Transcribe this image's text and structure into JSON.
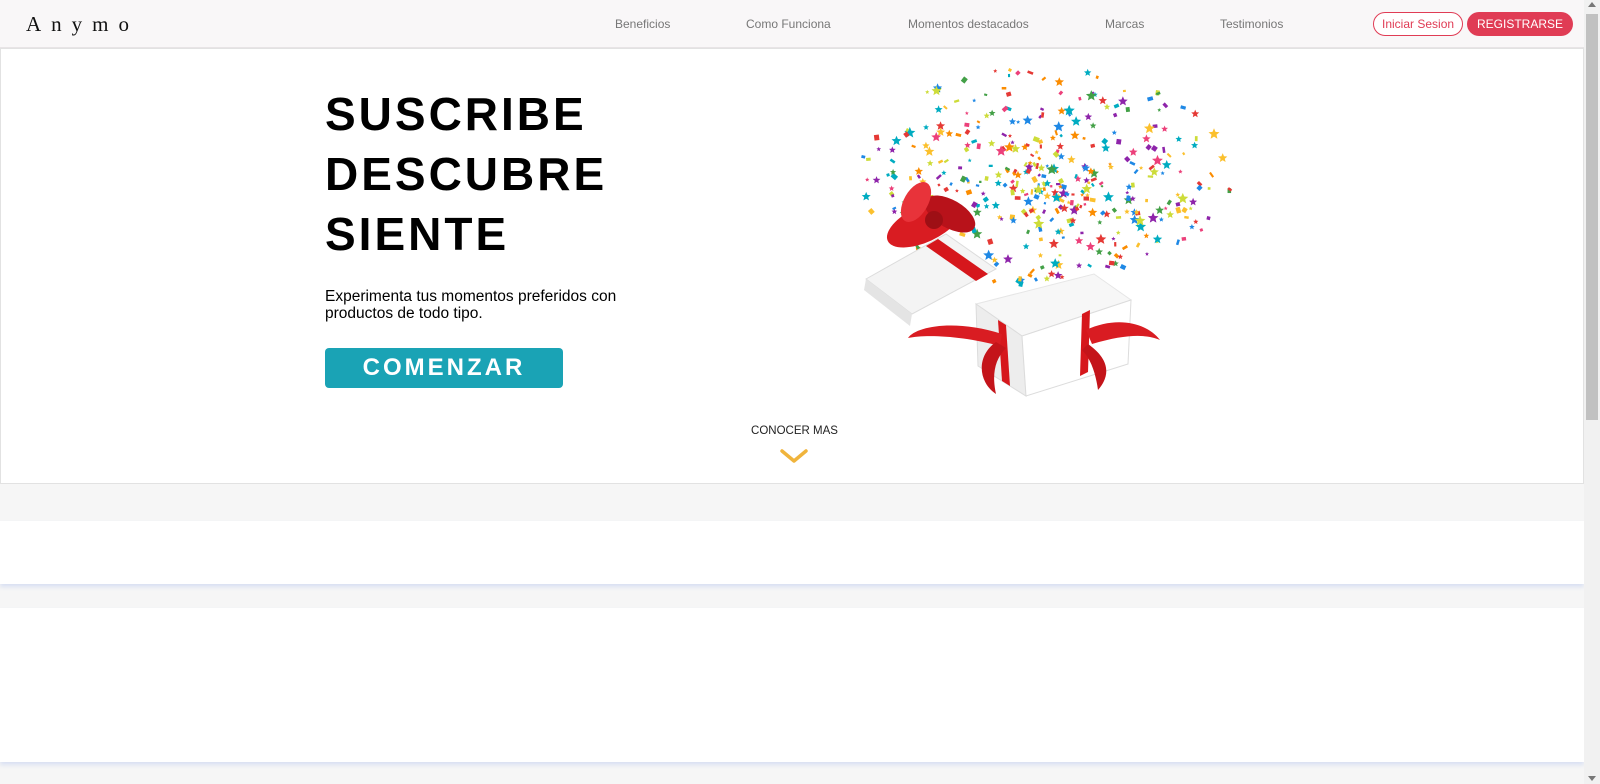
{
  "brand": "Anymo",
  "nav": {
    "links": [
      "Beneficios",
      "Como Funciona",
      "Momentos destacados",
      "Marcas",
      "Testimonios"
    ],
    "login_label": "Iniciar Sesion",
    "register_label": "REGISTRARSE"
  },
  "hero": {
    "headline": [
      "SUSCRIBE",
      "DESCUBRE",
      "SIENTE"
    ],
    "subtitle": "Experimenta tus momentos preferidos con productos de todo tipo.",
    "cta_label": "COMENZAR",
    "learn_more_label": "CONOCER MAS",
    "illustration_icon": "gift-box-confetti-icon"
  },
  "colors": {
    "accent_red": "#e03c55",
    "cta_teal": "#1aa3b5",
    "chevron_gold": "#f0b43c"
  }
}
